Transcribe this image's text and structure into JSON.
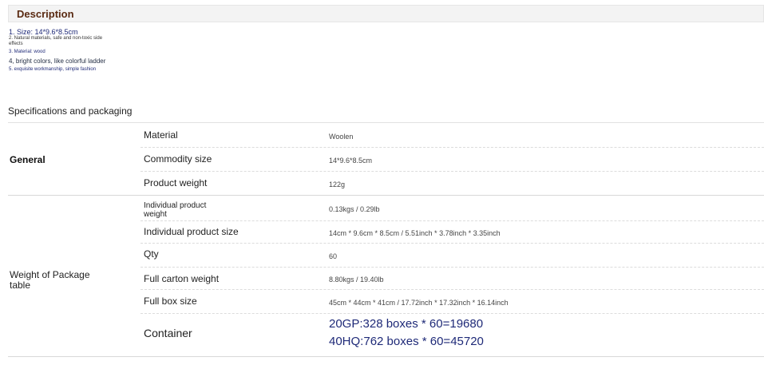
{
  "description": {
    "title": "Description",
    "items": [
      "1. Size: 14*9.6*8.5cm",
      "2. Natural materials, safe and non-toxic side effects",
      "3. Material: wood",
      "4, bright colors, like colorful ladder",
      "5. exquisite workmanship, simple fashion"
    ]
  },
  "specs": {
    "title": "Specifications and packaging",
    "general": {
      "label": "General",
      "rows": [
        {
          "key": "Material",
          "value": "Woolen"
        },
        {
          "key": "Commodity size",
          "value": "14*9.6*8.5cm"
        },
        {
          "key": "Product weight",
          "value": "122g"
        }
      ]
    },
    "package": {
      "label": "Weight of Package table",
      "rows": [
        {
          "key": "Individual product weight",
          "value": "0.13kgs / 0.29lb"
        },
        {
          "key": "Individual product size",
          "value": "14cm * 9.6cm * 8.5cm / 5.51inch * 3.78inch * 3.35inch"
        },
        {
          "key": "Qty",
          "value": "60"
        },
        {
          "key": "Full carton weight",
          "value": "8.80kgs / 19.40lb"
        },
        {
          "key": "Full box size",
          "value": "45cm * 44cm * 41cm / 17.72inch * 17.32inch * 16.14inch"
        },
        {
          "key": "Container",
          "value": "20GP:328 boxes * 60=19680",
          "value2": "40HQ:762 boxes * 60=45720"
        }
      ]
    }
  }
}
